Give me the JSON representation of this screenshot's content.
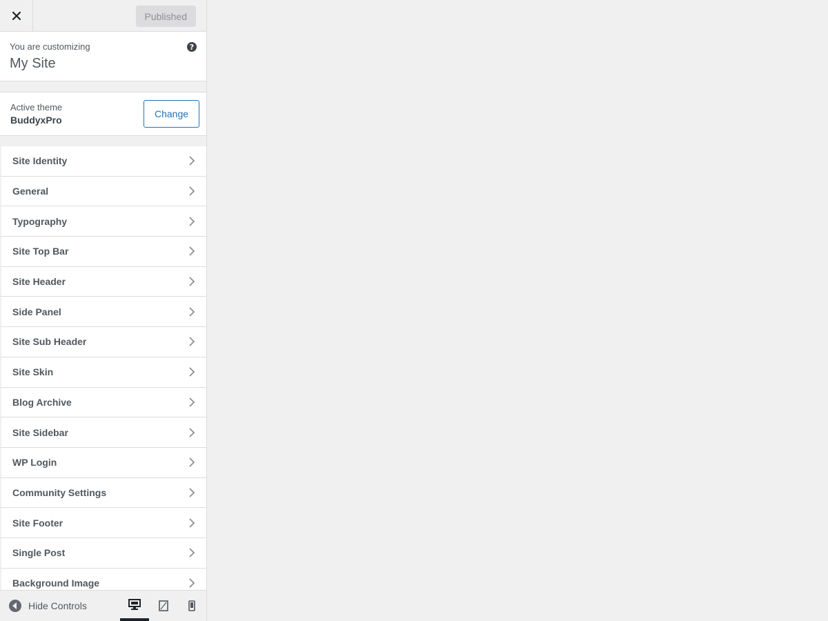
{
  "header": {
    "close_icon": "close-icon",
    "publish_label": "Published"
  },
  "info": {
    "label": "You are customizing",
    "site_title": "My Site",
    "help_icon": "?"
  },
  "theme": {
    "label": "Active theme",
    "name": "BuddyxPro",
    "change_label": "Change"
  },
  "sections": [
    {
      "label": "Site Identity"
    },
    {
      "label": "General"
    },
    {
      "label": "Typography"
    },
    {
      "label": "Site Top Bar"
    },
    {
      "label": "Site Header"
    },
    {
      "label": "Side Panel"
    },
    {
      "label": "Site Sub Header"
    },
    {
      "label": "Site Skin"
    },
    {
      "label": "Blog Archive"
    },
    {
      "label": "Site Sidebar"
    },
    {
      "label": "WP Login"
    },
    {
      "label": "Community Settings"
    },
    {
      "label": "Site Footer"
    },
    {
      "label": "Single Post"
    },
    {
      "label": "Background Image"
    }
  ],
  "footer": {
    "hide_label": "Hide Controls",
    "devices": [
      "desktop-icon",
      "tablet-icon",
      "mobile-icon"
    ],
    "active_device": "desktop"
  },
  "colors": {
    "accent": "#2271b1",
    "background": "#f0f0f1",
    "text": "#50575e"
  }
}
